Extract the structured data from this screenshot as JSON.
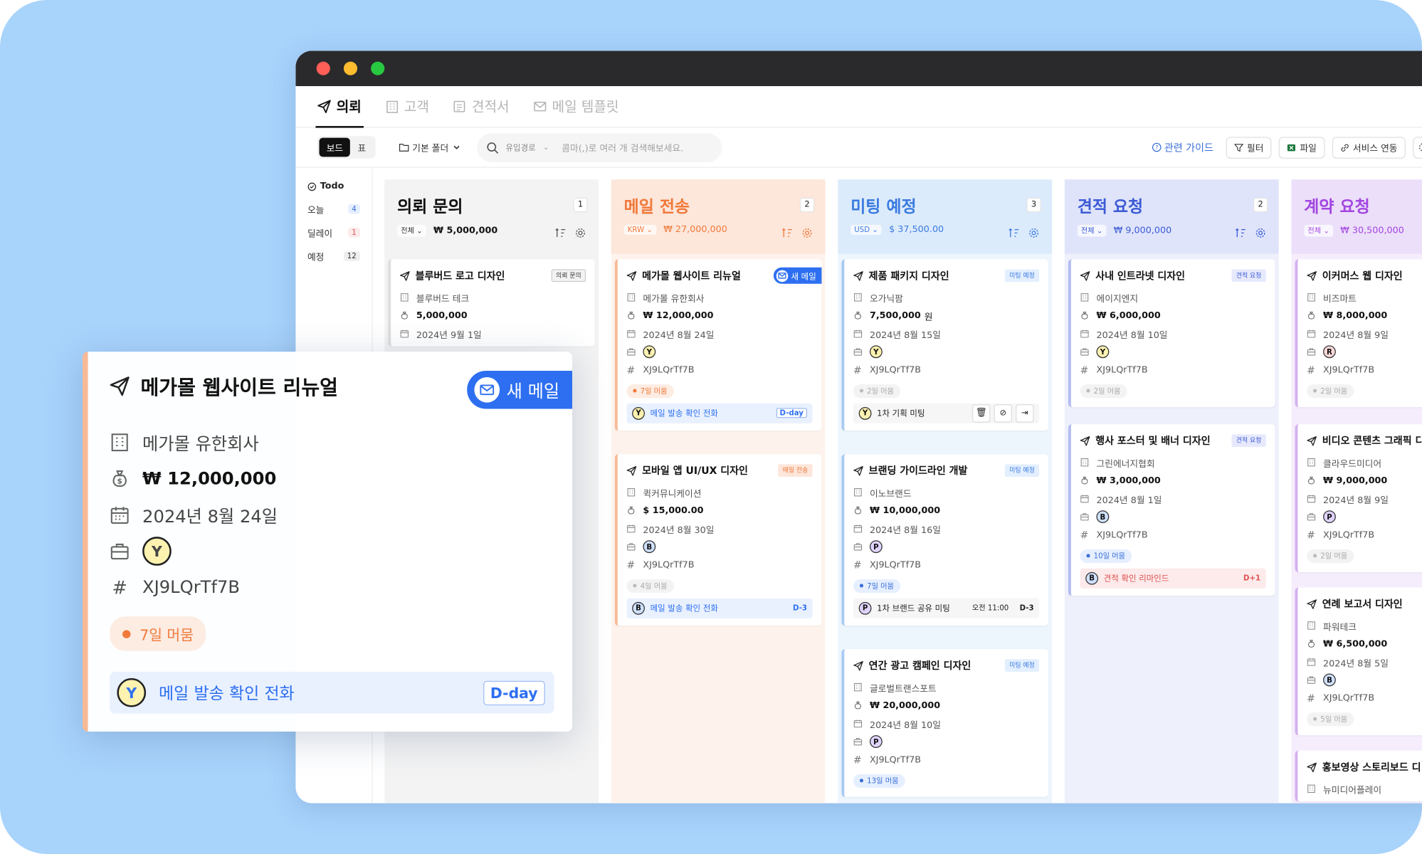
{
  "nav": {
    "tabs": [
      {
        "label": "의뢰"
      },
      {
        "label": "고객"
      },
      {
        "label": "견적서"
      },
      {
        "label": "메일 템플릿"
      }
    ]
  },
  "toolbar": {
    "view_board": "보드",
    "view_table": "표",
    "folder": "기본 폴더",
    "search_filter": "유입경로",
    "search_placeholder": "콤마(,)로 여러 개 검색해보세요.",
    "guide": "관련 가이드",
    "filter": "필터",
    "file": "파일",
    "service": "서비스 연동"
  },
  "sidebar": {
    "todo": "Todo",
    "items": [
      {
        "label": "오늘",
        "count": "4"
      },
      {
        "label": "딜레이",
        "count": "1"
      },
      {
        "label": "예정",
        "count": "12"
      }
    ]
  },
  "columns": [
    {
      "title": "의뢰 문의",
      "count": "1",
      "currency": "전체",
      "total": "₩ 5,000,000",
      "color": "#111111",
      "cards": [
        {
          "title": "블루버드 로고 디자인",
          "tag": "의뢰 문의",
          "company": "블루버드 테크",
          "amount": "5,000,000",
          "date": "2024년 9월 1일"
        }
      ]
    },
    {
      "title": "메일 전송",
      "count": "2",
      "currency": "KRW",
      "total": "₩ 27,000,000",
      "color": "#f07a3b",
      "cards": [
        {
          "title": "메가몰 웹사이트 리뉴얼",
          "company": "메가몰 유한회사",
          "amount": "₩ 12,000,000",
          "date": "2024년 8월 24일",
          "avatar": "Y",
          "code": "XJ9LQrTf7B",
          "stay": "7일 머뭄",
          "task": "메일 발송 확인 전화",
          "due": "D-day",
          "new_mail": "새 메일"
        },
        {
          "title": "모바일 앱 UI/UX 디자인",
          "tag": "메일 전송",
          "company": "퀵커뮤니케이션",
          "amount": "$ 15,000.00",
          "date": "2024년 8월 30일",
          "avatar": "B",
          "code": "XJ9LQrTf7B",
          "stay": "4일 머뭄",
          "task": "메일 발송 확인 전화",
          "due": "D-3"
        }
      ]
    },
    {
      "title": "미팅 예정",
      "count": "3",
      "currency": "USD",
      "total": "$ 37,500.00",
      "color": "#3b7be0",
      "cards": [
        {
          "title": "제품 패키지 디자인",
          "tag": "미팅 예정",
          "company": "오가닉팜",
          "amount": "7,500,000",
          "unit": "원",
          "date": "2024년 8월 15일",
          "avatar": "Y",
          "code": "XJ9LQrTf7B",
          "stay": "2일 머뭄",
          "task": "1차 기획 미팅"
        },
        {
          "title": "브랜딩 가이드라인 개발",
          "tag": "미팅 예정",
          "company": "이노브랜드",
          "amount": "₩ 10,000,000",
          "date": "2024년 8월 16일",
          "avatar": "P",
          "code": "XJ9LQrTf7B",
          "stay": "7일 머뭄",
          "task": "1차 브랜드 공유 미팅",
          "time": "오전 11:00",
          "due": "D-3"
        },
        {
          "title": "연간 광고 캠페인 디자인",
          "tag": "미팅 예정",
          "company": "글로벌트랜스포트",
          "amount": "₩ 20,000,000",
          "date": "2024년 8월 10일",
          "avatar": "P",
          "code": "XJ9LQrTf7B",
          "stay": "13일 머뭄"
        }
      ]
    },
    {
      "title": "견적 요청",
      "count": "2",
      "currency": "전체",
      "total": "₩ 9,000,000",
      "color": "#3d5bd6",
      "cards": [
        {
          "title": "사내 인트라넷 디자인",
          "tag": "견적 요청",
          "company": "에이지엔지",
          "amount": "₩ 6,000,000",
          "date": "2024년 8월 10일",
          "avatar": "Y",
          "code": "XJ9LQrTf7B",
          "stay": "2일 머뭄"
        },
        {
          "title": "행사 포스터 및 배너 디자인",
          "tag": "견적 요청",
          "company": "그린에너지협회",
          "amount": "₩ 3,000,000",
          "date": "2024년 8월 1일",
          "avatar": "B",
          "code": "XJ9LQrTf7B",
          "stay": "10일 머뭄",
          "task": "견적 확인 리마인드",
          "due": "D+1"
        }
      ]
    },
    {
      "title": "계약 요청",
      "count": "",
      "currency": "전체",
      "total": "₩ 30,500,000",
      "color": "#a347e0",
      "cards": [
        {
          "title": "이커머스 웹 디자인",
          "company": "비즈마트",
          "amount": "₩ 8,000,000",
          "date": "2024년 8월 9일",
          "avatar": "R",
          "code": "XJ9LQrTf7B",
          "stay": "2일 머뭄"
        },
        {
          "title": "비디오 콘텐츠 그래픽 디",
          "company": "클라우드미디어",
          "amount": "₩ 9,000,000",
          "date": "2024년 8월 9일",
          "avatar": "P",
          "code": "XJ9LQrTf7B",
          "stay": "2일 머뭄"
        },
        {
          "title": "연례 보고서 디자인",
          "company": "파워테크",
          "amount": "₩ 6,500,000",
          "date": "2024년 8월 5일",
          "avatar": "B",
          "code": "XJ9LQrTf7B",
          "stay": "5일 머뭄"
        },
        {
          "title": "홍보영상 스토리보드 디",
          "company": "뉴미디어플레이"
        }
      ]
    }
  ],
  "detail": {
    "title": "메가몰 웹사이트 리뉴얼",
    "new_mail": "새 메일",
    "company": "메가몰 유한회사",
    "amount": "₩ 12,000,000",
    "date": "2024년 8월 24일",
    "avatar": "Y",
    "code": "XJ9LQrTf7B",
    "stay": "7일 머뭄",
    "task": "메일 발송 확인 전화",
    "due": "D-day"
  }
}
